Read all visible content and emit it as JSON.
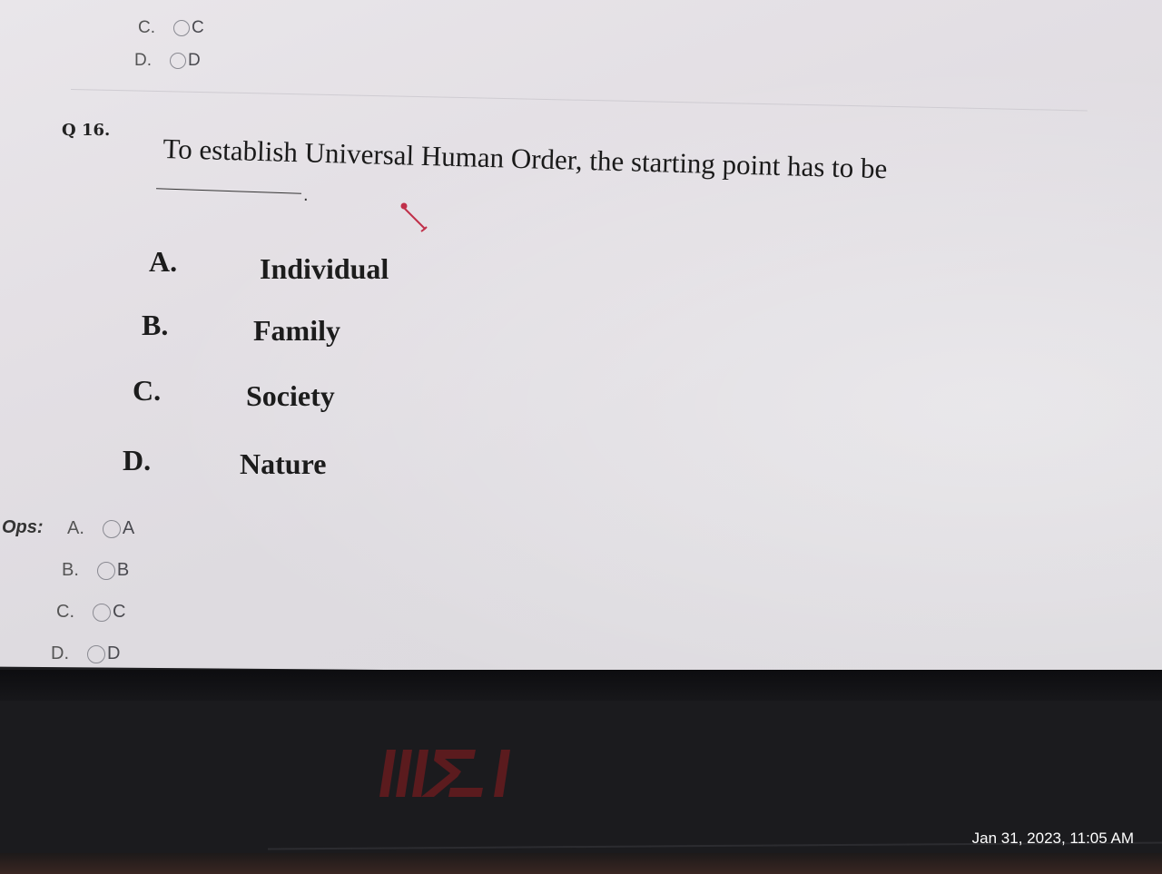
{
  "prev_options": [
    {
      "letter": "C.",
      "value": "C"
    },
    {
      "letter": "D.",
      "value": "D"
    }
  ],
  "question": {
    "number": "Q 16.",
    "text": "To establish Universal Human Order, the starting point has to be",
    "blank_suffix": "."
  },
  "choices": [
    {
      "letter": "A.",
      "text": "Individual"
    },
    {
      "letter": "B.",
      "text": "Family"
    },
    {
      "letter": "C.",
      "text": "Society"
    },
    {
      "letter": "D.",
      "text": "Nature"
    }
  ],
  "answer": {
    "label": "Ops:",
    "options": [
      {
        "letter": "A.",
        "value": "A"
      },
      {
        "letter": "B.",
        "value": "B"
      },
      {
        "letter": "C.",
        "value": "C"
      },
      {
        "letter": "D.",
        "value": "D"
      }
    ]
  },
  "laptop_brand": "MSI",
  "photo_timestamp": "Jan 31, 2023, 11:05 AM",
  "colors": {
    "screen": "#e3dfe4",
    "bezel": "#17171a",
    "logo": "#5b1b1e",
    "cursor": "#c0304a"
  }
}
